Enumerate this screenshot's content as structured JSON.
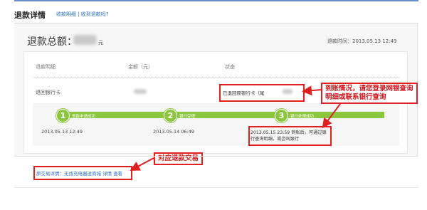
{
  "header": {
    "title": "退款详情",
    "subtitle": "收款明细 | 收到退款吗?"
  },
  "summary": {
    "total_label": "退款总额：",
    "unit": "元",
    "refund_time": "退款时间：2013.05.13 12:49"
  },
  "table": {
    "headers": [
      "退款明细",
      "金额（元）",
      "状态"
    ],
    "row_label": "退回银行卡",
    "bank_status": "已退回原银行卡（尾"
  },
  "progress": {
    "steps": [
      {
        "num": "1",
        "label": "退款申请成功",
        "time": "2013.05.13 12:49"
      },
      {
        "num": "2",
        "label": "银行受理",
        "time": "2013.05.14 06:49"
      },
      {
        "num": "3",
        "label": "银行处理成功",
        "time": ""
      }
    ],
    "note": "2013.05.15 23:59 到账后，可通过银行查询明细，或咨询银行"
  },
  "annotations": {
    "right": "到账情况，请您登录网银查询明细或联系银行查询",
    "middle": "对应退款交易"
  },
  "original": {
    "text": "原交易详情：无线充电器送商城 详情 查看"
  },
  "colors": {
    "accent_green": "#8cc63f",
    "highlight_red": "#e02020",
    "link_blue": "#2f72c9"
  }
}
